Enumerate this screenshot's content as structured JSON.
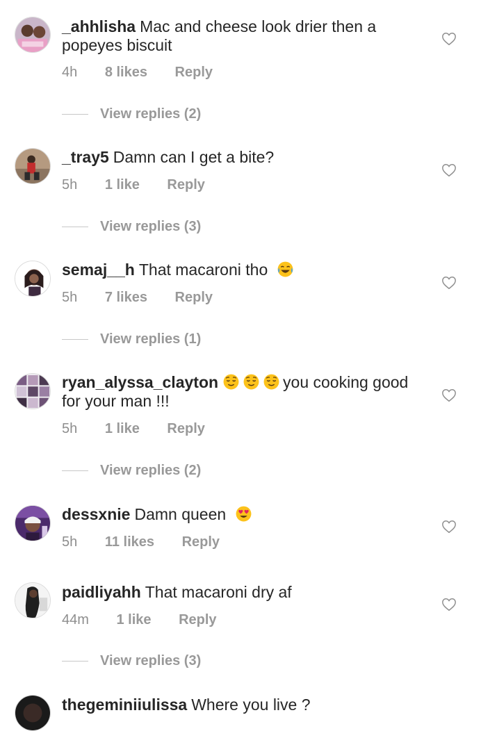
{
  "colors": {
    "text": "#262626",
    "secondary": "#8e8e8e",
    "divider": "#c7c7c7"
  },
  "comments": [
    {
      "username": "_ahhlisha",
      "text": "Mac and cheese look drier then a popeyes biscuit",
      "time": "4h",
      "likes": "8 likes",
      "reply": "Reply",
      "view_replies": "View replies (2)"
    },
    {
      "username": "_tray5",
      "text": "Damn can I get a bite?",
      "time": "5h",
      "likes": "1 like",
      "reply": "Reply",
      "view_replies": "View replies (3)"
    },
    {
      "username": "semaj__h",
      "text": "That macaroni tho",
      "emoji": "face-with-tears-of-joy",
      "time": "5h",
      "likes": "7 likes",
      "reply": "Reply",
      "view_replies": "View replies (1)"
    },
    {
      "username": "ryan_alyssa_clayton",
      "emoji": "relieved-face x3",
      "text": "you cooking good for your man !!!",
      "time": "5h",
      "likes": "1 like",
      "reply": "Reply",
      "view_replies": "View replies (2)"
    },
    {
      "username": "dessxnie",
      "text": "Damn queen",
      "emoji": "heart-eyes-face",
      "time": "5h",
      "likes": "11 likes",
      "reply": "Reply"
    },
    {
      "username": "paidliyahh",
      "text": "That macaroni dry af",
      "time": "44m",
      "likes": "1 like",
      "reply": "Reply",
      "view_replies": "View replies (3)"
    },
    {
      "username": "thegeminiiulissa",
      "text": "Where you live ?"
    }
  ]
}
